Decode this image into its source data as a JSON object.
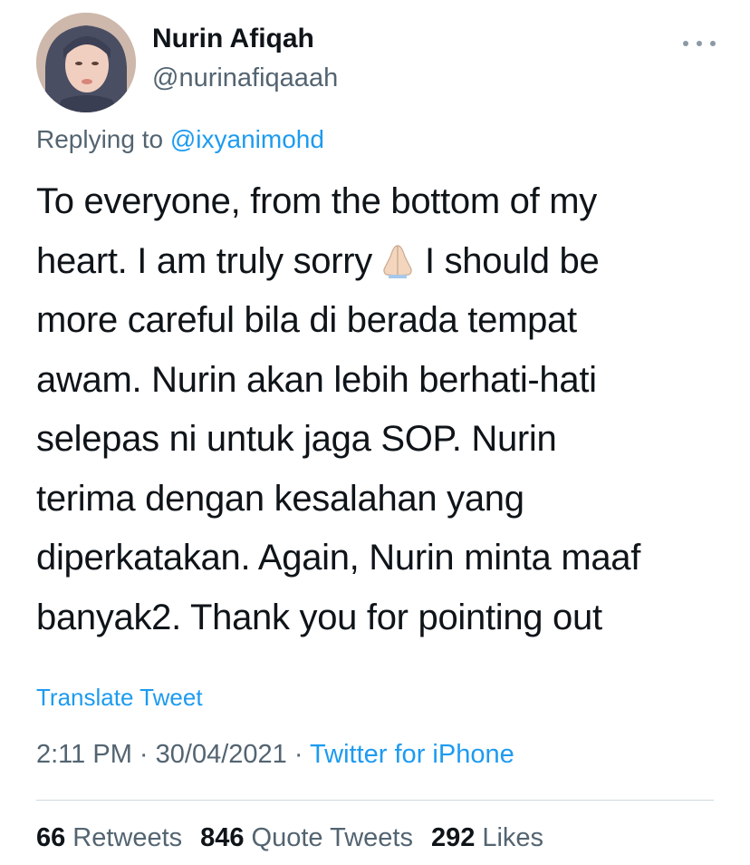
{
  "author": {
    "display_name": "Nurin Afiqah",
    "handle": "@nurinafiqaaah"
  },
  "reply_context": {
    "prefix": "Replying to",
    "mention": "@ixyanimohd"
  },
  "tweet": {
    "lines": [
      "To everyone, from the bottom of my",
      "heart. I am truly sorry",
      "I should be",
      "more careful bila di berada tempat",
      "awam. Nurin akan lebih berhati-hati",
      "selepas ni untuk jaga SOP. Nurin",
      "terima dengan kesalahan yang",
      "diperkatakan. Again, Nurin minta maaf",
      "banyak2. Thank you for pointing out"
    ],
    "emoji": "folded-hands-icon"
  },
  "translate_label": "Translate Tweet",
  "meta": {
    "time": "2:11 PM",
    "separator": " · ",
    "date": "30/04/2021",
    "source": "Twitter for iPhone"
  },
  "stats": {
    "retweets_count": "66",
    "retweets_label": "Retweets",
    "quotes_count": "846",
    "quotes_label": "Quote Tweets",
    "likes_count": "292",
    "likes_label": "Likes"
  },
  "colors": {
    "accent": "#1d9bf0",
    "text": "#0f1419",
    "muted": "#536471"
  }
}
